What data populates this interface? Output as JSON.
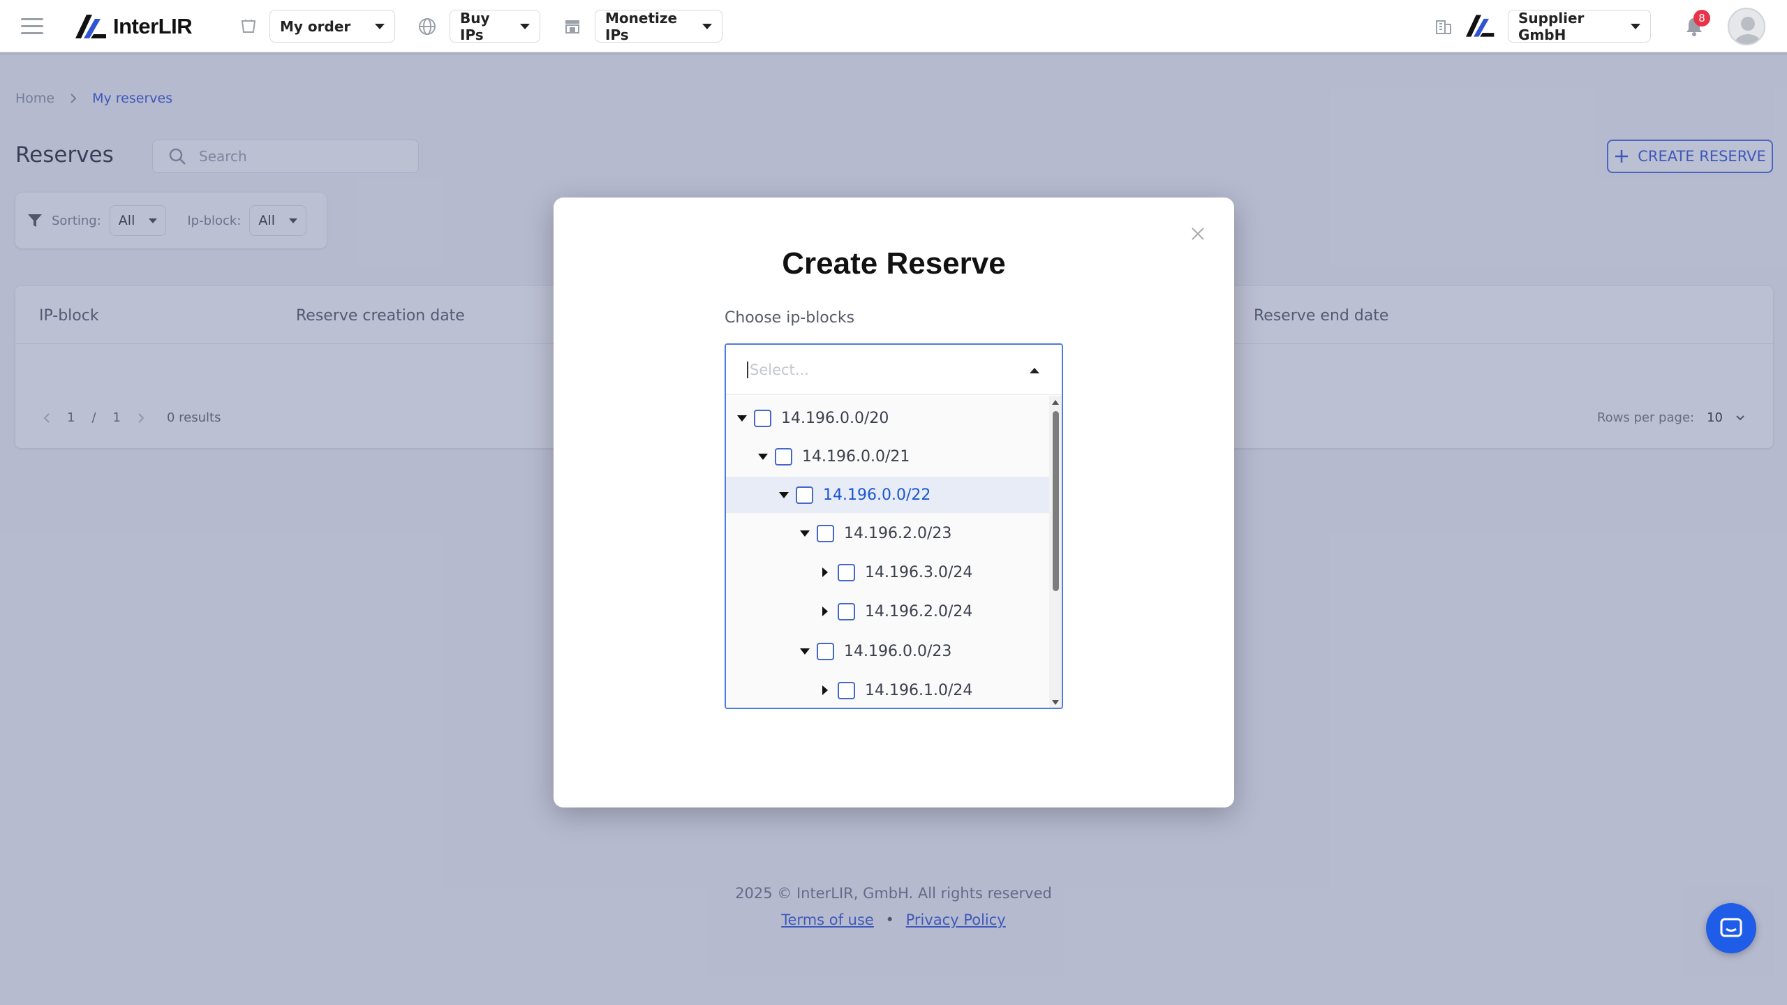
{
  "header": {
    "brand": "InterLIR",
    "nav": [
      {
        "icon": "cart-icon",
        "label": "My order"
      },
      {
        "icon": "globe-icon",
        "label": "Buy IPs"
      },
      {
        "icon": "store-icon",
        "label": "Monetize IPs"
      }
    ],
    "company": "Supplier GmbH",
    "notifications_count": "8"
  },
  "breadcrumb": {
    "home": "Home",
    "current": "My reserves"
  },
  "page": {
    "title": "Reserves",
    "search_placeholder": "Search",
    "create_label": "CREATE RESERVE"
  },
  "filters": {
    "sorting_label": "Sorting:",
    "sorting_value": "All",
    "ipblock_label": "Ip-block:",
    "ipblock_value": "All"
  },
  "table": {
    "columns": [
      "IP-block",
      "Reserve creation date",
      "Reserve end date"
    ],
    "page_current": "1",
    "page_sep": "/",
    "page_total": "1",
    "results_count": "0",
    "results_label": "results",
    "rows_per_page_label": "Rows per page:",
    "rows_per_page_value": "10"
  },
  "footer": {
    "copyright": "2025 © InterLIR, GmbH. All rights reserved",
    "terms": "Terms of use",
    "separator": "•",
    "privacy": "Privacy Policy"
  },
  "modal": {
    "title": "Create Reserve",
    "field_label": "Choose ip-blocks",
    "placeholder": "Select...",
    "tree": [
      {
        "label": "14.196.0.0/20",
        "level": 0,
        "expanded": true,
        "selected": false
      },
      {
        "label": "14.196.0.0/21",
        "level": 1,
        "expanded": true,
        "selected": false
      },
      {
        "label": "14.196.0.0/22",
        "level": 2,
        "expanded": true,
        "selected": true
      },
      {
        "label": "14.196.2.0/23",
        "level": 3,
        "expanded": true,
        "selected": false
      },
      {
        "label": "14.196.3.0/24",
        "level": 4,
        "expanded": false,
        "selected": false
      },
      {
        "label": "14.196.2.0/24",
        "level": 4,
        "expanded": false,
        "selected": false
      },
      {
        "label": "14.196.0.0/23",
        "level": 3,
        "expanded": true,
        "selected": false
      },
      {
        "label": "14.196.1.0/24",
        "level": 4,
        "expanded": false,
        "selected": false
      }
    ]
  },
  "colors": {
    "accent": "#3559d6",
    "overlay": "#505a8c",
    "badge": "#e8334a",
    "chat": "#1f5de8"
  }
}
